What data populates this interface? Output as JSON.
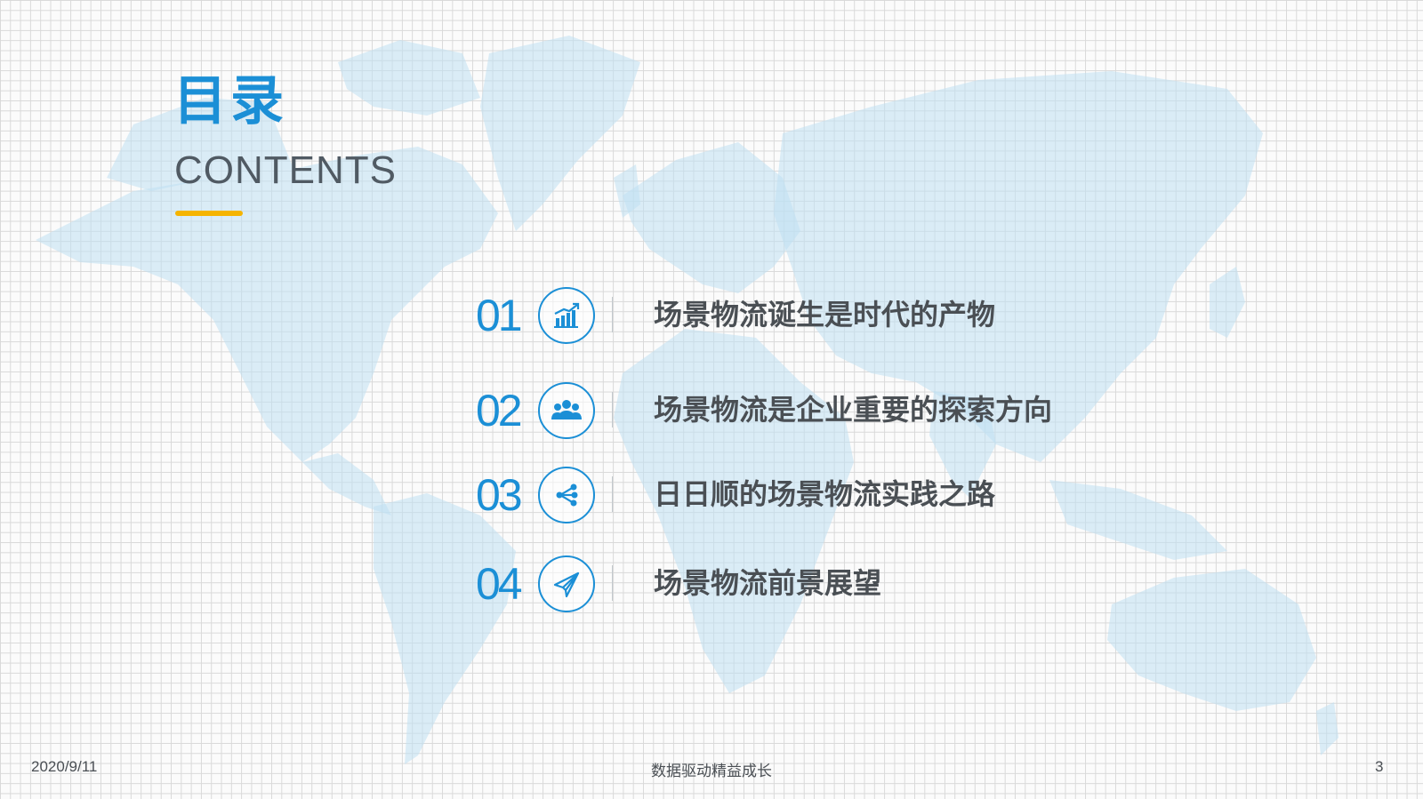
{
  "title": {
    "cn": "目录",
    "en": "CONTENTS"
  },
  "accent_color": "#1b8fd6",
  "underline_color": "#f5b400",
  "items": [
    {
      "number": "01",
      "label": "场景物流诞生是时代的产物",
      "icon": "rising-chart-icon"
    },
    {
      "number": "02",
      "label": "场景物流是企业重要的探索方向",
      "icon": "people-group-icon"
    },
    {
      "number": "03",
      "label": "日日顺的场景物流实践之路",
      "icon": "share-network-icon"
    },
    {
      "number": "04",
      "label": "场景物流前景展望",
      "icon": "paper-plane-icon"
    }
  ],
  "footer": {
    "date": "2020/9/11",
    "center": "数据驱动精益成长",
    "page": "3"
  }
}
